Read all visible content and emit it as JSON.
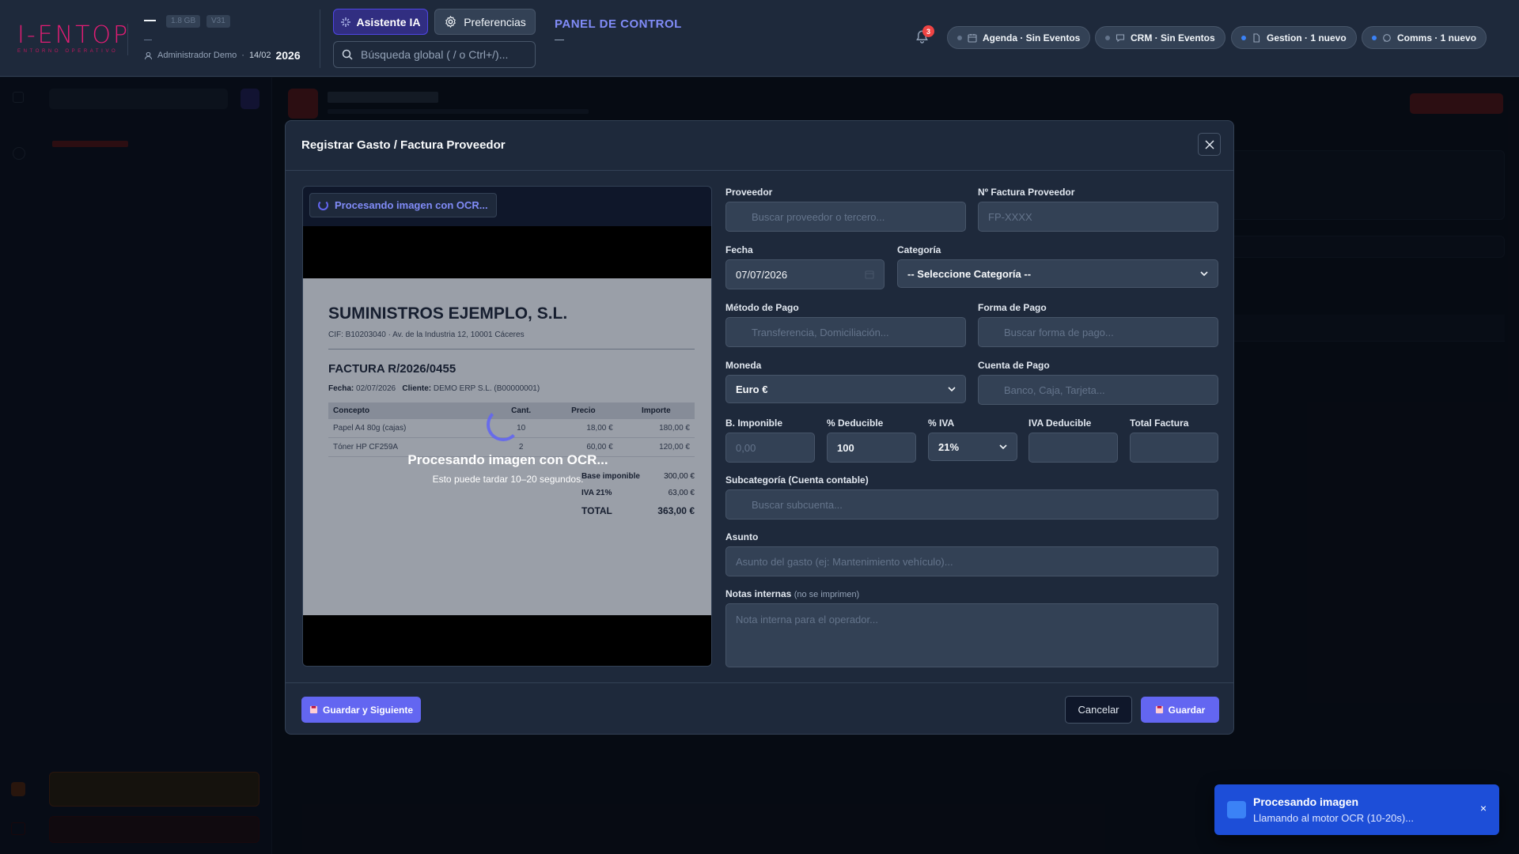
{
  "app": {
    "logo": "I-ENTOP",
    "logo_sub": "ENTORNO OPERATIVO",
    "header_dash": "—",
    "storage_chip": "1.8 GB",
    "version_chip": "V31",
    "user": "Administrador Demo",
    "separator": "·",
    "date": "14/02",
    "year": "2026",
    "ai_button": "Asistente IA",
    "prefs_button": "Preferencias",
    "search_placeholder": "Búsqueda global ( / o Ctrl+/)...",
    "panel_title": "PANEL DE CONTROL",
    "notifications_count": "3"
  },
  "status_pills": [
    {
      "label": "Agenda · Sin Eventos",
      "dot": "#64748b"
    },
    {
      "label": "CRM · Sin Eventos",
      "dot": "#64748b"
    },
    {
      "label": "Gestion · 1 nuevo",
      "dot": "#3b82f6"
    },
    {
      "label": "Comms · 1 nuevo",
      "dot": "#3b82f6"
    }
  ],
  "modal": {
    "title": "Registrar Gasto / Factura Proveedor",
    "ocr_chip": "Procesando imagen con OCR...",
    "invoice": {
      "company": "SUMINISTROS EJEMPLO, S.L.",
      "cif_line": "CIF: B10203040 · Av. de la Industria 12, 10001 Cáceres",
      "title": "FACTURA R/2026/0455",
      "date_label": "Fecha:",
      "date_value": "02/07/2026",
      "client_label": "Cliente:",
      "client_value": "DEMO ERP S.L. (B00000001)",
      "headers": [
        "Concepto",
        "Cant.",
        "Precio",
        "Importe"
      ],
      "rows": [
        [
          "Papel A4 80g (cajas)",
          "10",
          "18,00 €",
          "180,00 €"
        ],
        [
          "Tóner HP CF259A",
          "2",
          "60,00 €",
          "120,00 €"
        ]
      ],
      "base_label": "Base imponible",
      "base_value": "300,00 €",
      "iva_label": "IVA 21%",
      "iva_value": "63,00 €",
      "total_label": "TOTAL",
      "total_value": "363,00 €"
    },
    "processing_title": "Procesando imagen con OCR...",
    "processing_sub": "Esto puede tardar 10–20 segundos.",
    "fields": {
      "proveedor_label": "Proveedor",
      "proveedor_placeholder": "Buscar proveedor o tercero...",
      "factura_label": "Nº Factura Proveedor",
      "factura_placeholder": "FP-XXXX",
      "fecha_label": "Fecha",
      "fecha_value": "07/07/2026",
      "categoria_label": "Categoría",
      "categoria_value": "-- Seleccione Categoría --",
      "metodo_label": "Método de Pago",
      "metodo_placeholder": "Transferencia, Domiciliación...",
      "forma_label": "Forma de Pago",
      "forma_placeholder": "Buscar forma de pago...",
      "moneda_label": "Moneda",
      "moneda_value": "Euro €",
      "cuenta_label": "Cuenta de Pago",
      "cuenta_placeholder": "Banco, Caja, Tarjeta...",
      "base_label": "B. Imponible",
      "base_placeholder": "0,00",
      "deducible_label": "% Deducible",
      "deducible_value": "100",
      "iva_label": "% IVA",
      "iva_value": "21%",
      "iva_deducible_label": "IVA Deducible",
      "total_label": "Total Factura",
      "subcat_label": "Subcategoría (Cuenta contable)",
      "subcat_placeholder": "Buscar subcuenta...",
      "asunto_label": "Asunto",
      "asunto_placeholder": "Asunto del gasto (ej: Mantenimiento vehículo)...",
      "notas_label": "Notas internas",
      "notas_hint": "(no se imprimen)",
      "notas_placeholder": "Nota interna para el operador..."
    },
    "save_next": "Guardar y Siguiente",
    "cancel": "Cancelar",
    "save": "Guardar"
  },
  "toast": {
    "title": "Procesando imagen",
    "message": "Llamando al motor OCR (10-20s)...",
    "close": "×"
  }
}
